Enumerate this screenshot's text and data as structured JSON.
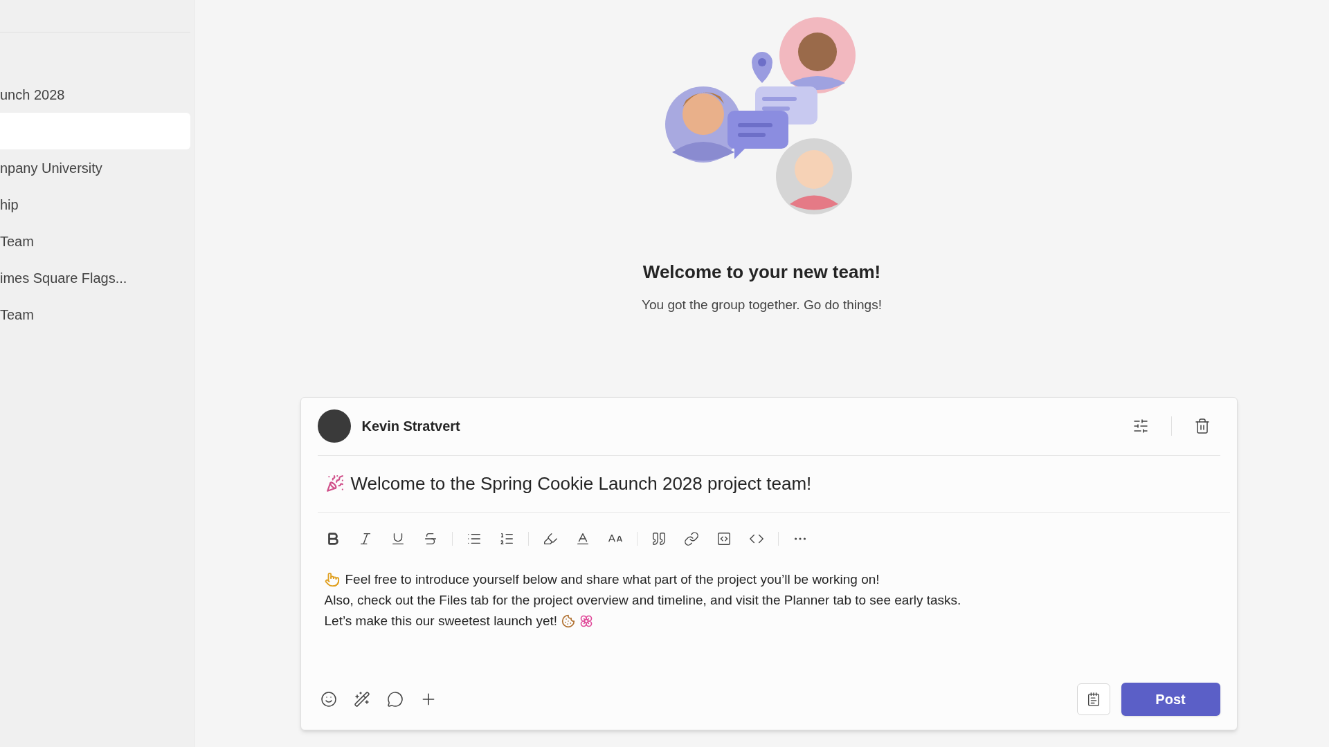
{
  "sidebar": {
    "items": [
      {
        "label": "unch 2028",
        "selected": false
      },
      {
        "selected": true
      },
      {
        "label": "npany University",
        "selected": false
      },
      {
        "label": "hip",
        "selected": false
      },
      {
        "label": "Team",
        "selected": false
      },
      {
        "label": "imes Square Flags...",
        "selected": false
      },
      {
        "label": "Team",
        "selected": false
      }
    ]
  },
  "welcome": {
    "title": "Welcome to your new team!",
    "subtitle": "You got the group together. Go do things!"
  },
  "composer": {
    "author": "Kevin Stratvert",
    "subject": "Welcome to the Spring Cookie Launch 2028 project team!",
    "body": [
      "Feel free to introduce yourself below and share what part of the project you’ll be working on!",
      "Also, check out the Files tab for the project overview and timeline, and visit the Planner tab to see early tasks.",
      "Let’s make this our sweetest launch yet!"
    ],
    "post_button": "Post"
  }
}
